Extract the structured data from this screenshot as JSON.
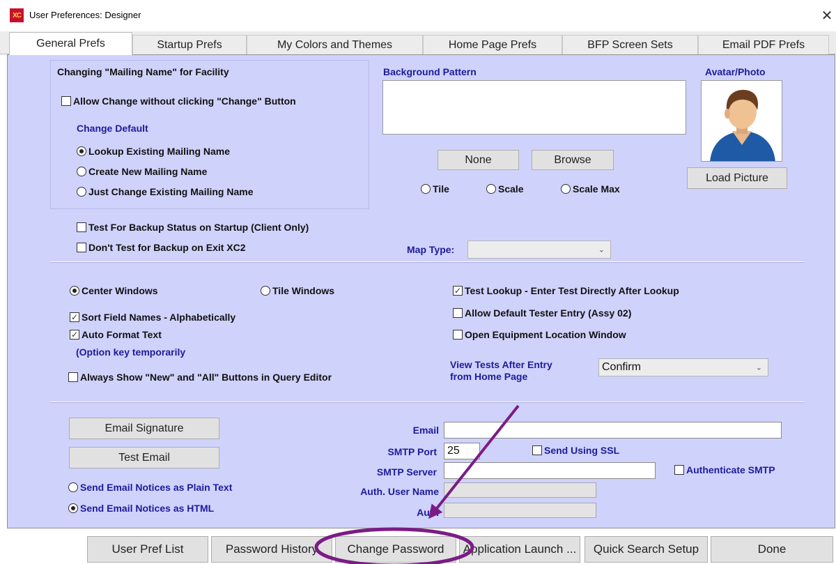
{
  "window": {
    "title": "User Preferences: Designer",
    "logo_text": "XC",
    "close_glyph": "✕"
  },
  "tabs": [
    {
      "label": "General Prefs",
      "active": true
    },
    {
      "label": "Startup Prefs"
    },
    {
      "label": "My Colors and Themes"
    },
    {
      "label": "Home Page Prefs"
    },
    {
      "label": "BFP Screen Sets"
    },
    {
      "label": "Email PDF Prefs"
    }
  ],
  "mailing": {
    "heading": "Changing \"Mailing Name\" for Facility",
    "allow_change": "Allow Change without clicking \"Change\" Button",
    "allow_change_checked": false,
    "change_default": "Change Default",
    "options": [
      {
        "label": "Lookup Existing Mailing Name",
        "selected": true
      },
      {
        "label": "Create New Mailing Name",
        "selected": false
      },
      {
        "label": "Just Change Existing Mailing Name",
        "selected": false
      }
    ]
  },
  "backup": {
    "test_startup": "Test For Backup Status on Startup  (Client Only)",
    "dont_test_exit": "Don't Test for Backup on Exit XC2"
  },
  "background": {
    "heading": "Background Pattern",
    "none_button": "None",
    "browse_button": "Browse",
    "options": [
      {
        "label": "Tile",
        "selected": false
      },
      {
        "label": "Scale",
        "selected": false
      },
      {
        "label": "Scale Max",
        "selected": false
      }
    ]
  },
  "avatar": {
    "heading": "Avatar/Photo",
    "load_button": "Load Picture"
  },
  "map": {
    "label": "Map Type:",
    "value": ""
  },
  "windows": {
    "center": {
      "label": "Center Windows",
      "selected": true
    },
    "tile": {
      "label": "Tile Windows",
      "selected": false
    },
    "sort_fields": {
      "label": "Sort Field Names - Alphabetically",
      "checked": true
    },
    "auto_format": {
      "label": "Auto Format Text",
      "checked": true
    },
    "option_key_note": "(Option key temporarily",
    "always_show": {
      "label": "Always Show \"New\" and \"All\" Buttons in Query Editor",
      "checked": false
    }
  },
  "tests": {
    "test_lookup": {
      "label": "Test Lookup - Enter Test Directly After Lookup",
      "checked": true
    },
    "default_tester": {
      "label": "Allow Default Tester Entry (Assy 02)",
      "checked": false
    },
    "open_equipment": {
      "label": "Open Equipment Location Window",
      "checked": false
    },
    "view_tests_line1": "View Tests After Entry",
    "view_tests_line2": "from Home Page",
    "view_tests_value": "Confirm"
  },
  "email": {
    "signature_button": "Email Signature",
    "test_button": "Test Email",
    "plain_text": {
      "label": "Send Email Notices as Plain Text",
      "selected": false
    },
    "html": {
      "label": "Send Email Notices as HTML",
      "selected": true
    },
    "email_label": "Email",
    "email_value": "",
    "smtp_port_label": "SMTP Port",
    "smtp_port_value": "25",
    "ssl_label": "Send Using SSL",
    "smtp_server_label": "SMTP Server",
    "smtp_server_value": "",
    "auth_smtp_label": "Authenticate SMTP",
    "auth_user_label": "Auth. User Name",
    "auth_user_value": "",
    "auth_label": "Auth",
    "auth_value": ""
  },
  "bottom_buttons": [
    "User Pref List",
    "Password History",
    "Change Password",
    "Application Launch ...",
    "Quick Search Setup",
    "Done"
  ],
  "annotation_color": "#7b1c86",
  "panel_color": "#cfd2fb"
}
